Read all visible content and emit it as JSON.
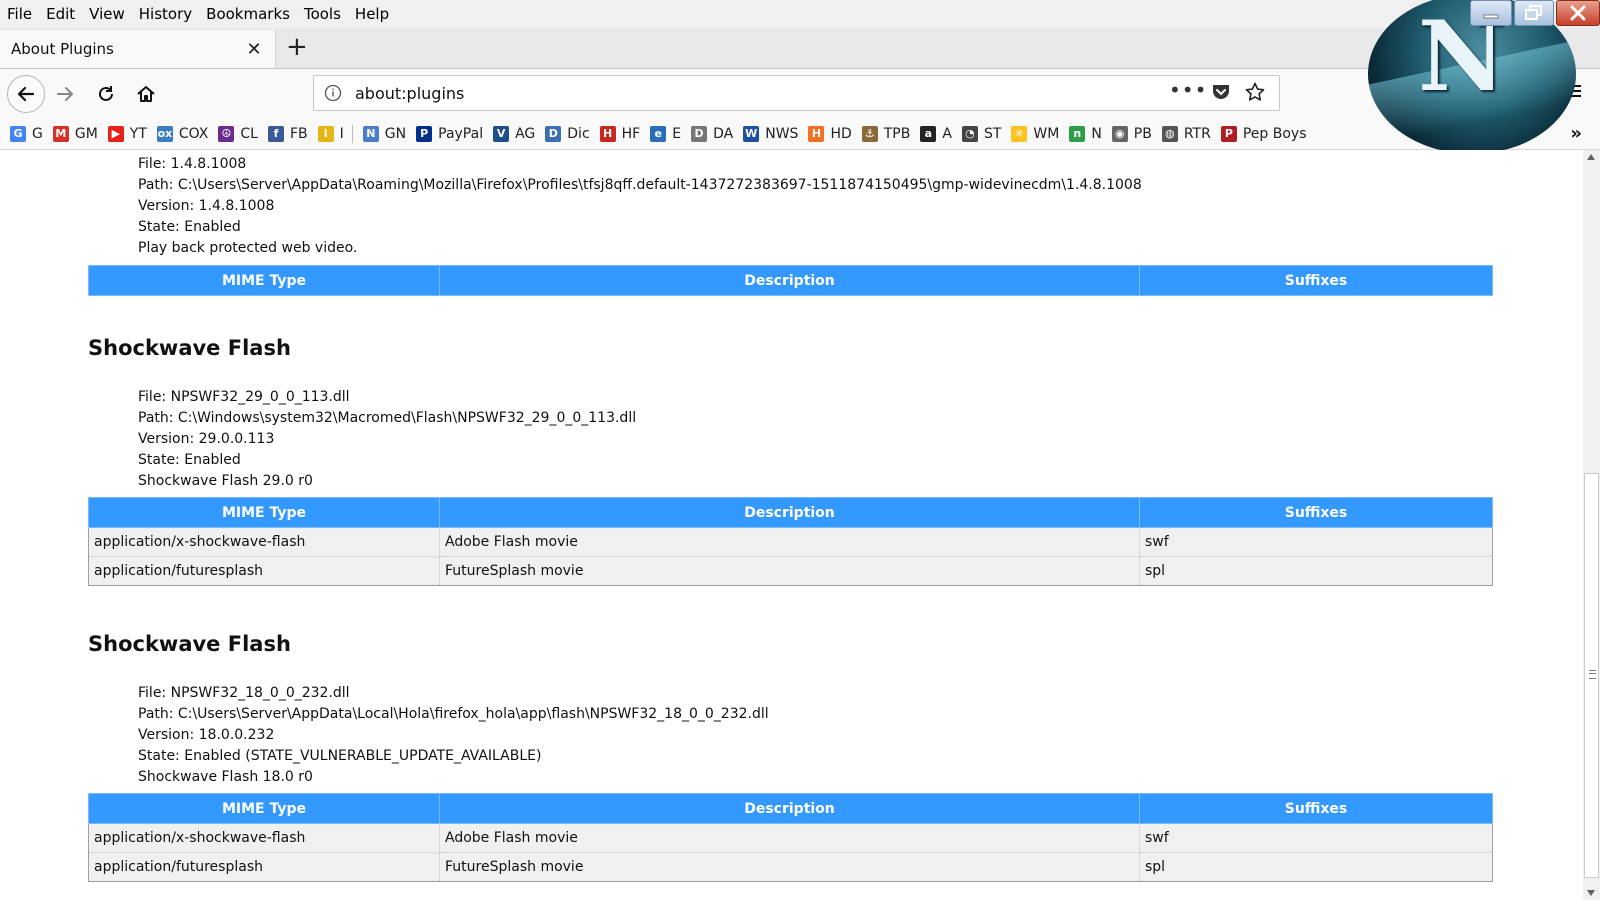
{
  "menu": [
    {
      "label": "File"
    },
    {
      "label": "Edit"
    },
    {
      "label": "View"
    },
    {
      "label": "History"
    },
    {
      "label": "Bookmarks"
    },
    {
      "label": "Tools"
    },
    {
      "label": "Help"
    }
  ],
  "tab": {
    "title": "About Plugins",
    "close": "✕",
    "new_tab": "+"
  },
  "urlbar": {
    "url": "about:plugins",
    "more": "•••"
  },
  "bookmarks": [
    {
      "label": "G",
      "icon": "google-icon",
      "color": "#4285f4",
      "glyph": "G"
    },
    {
      "label": "GM",
      "icon": "gmail-icon",
      "color": "#d93025",
      "glyph": "M"
    },
    {
      "label": "YT",
      "icon": "youtube-icon",
      "color": "#e62117",
      "glyph": "▶"
    },
    {
      "label": "COX",
      "icon": "cox-icon",
      "color": "#3a7fc1",
      "glyph": "ox"
    },
    {
      "label": "CL",
      "icon": "peace-icon",
      "color": "#6a2c91",
      "glyph": "☮"
    },
    {
      "label": "FB",
      "icon": "facebook-icon",
      "color": "#3b5998",
      "glyph": "f"
    },
    {
      "label": "I",
      "icon": "imdb-icon",
      "color": "#e2b616",
      "glyph": "i"
    },
    {
      "label": "GN",
      "icon": "google-news-icon",
      "color": "#4a7ec9",
      "glyph": "N"
    },
    {
      "label": "PayPal",
      "icon": "paypal-icon",
      "color": "#003087",
      "glyph": "P"
    },
    {
      "label": "AG",
      "icon": "ag-icon",
      "color": "#1e4f8a",
      "glyph": "V"
    },
    {
      "label": "Dic",
      "icon": "dictionary-icon",
      "color": "#3b6fb4",
      "glyph": "D"
    },
    {
      "label": "HF",
      "icon": "hf-icon",
      "color": "#c8281e",
      "glyph": "H"
    },
    {
      "label": "E",
      "icon": "ebay-icon",
      "color": "#2a6ebb",
      "glyph": "e"
    },
    {
      "label": "DA",
      "icon": "da-icon",
      "color": "#777777",
      "glyph": "D"
    },
    {
      "label": "NWS",
      "icon": "weather-channel-icon",
      "color": "#1f4fa0",
      "glyph": "W"
    },
    {
      "label": "HD",
      "icon": "home-depot-icon",
      "color": "#f36f21",
      "glyph": "H"
    },
    {
      "label": "TPB",
      "icon": "pirate-ship-icon",
      "color": "#8a6a3a",
      "glyph": "⚓"
    },
    {
      "label": "A",
      "icon": "amazon-icon",
      "color": "#222222",
      "glyph": "a"
    },
    {
      "label": "ST",
      "icon": "speedtest-icon",
      "color": "#444444",
      "glyph": "◔"
    },
    {
      "label": "WM",
      "icon": "walmart-icon",
      "color": "#ffc220",
      "glyph": "✳"
    },
    {
      "label": "N",
      "icon": "n-icon",
      "color": "#2e9d4a",
      "glyph": "n"
    },
    {
      "label": "PB",
      "icon": "camera-icon",
      "color": "#666666",
      "glyph": "◉"
    },
    {
      "label": "RTR",
      "icon": "globe-icon",
      "color": "#555555",
      "glyph": "◍"
    },
    {
      "label": "Pep Boys",
      "icon": "pep-boys-icon",
      "color": "#b01e23",
      "glyph": "P"
    }
  ],
  "bookmarks_overflow": "»",
  "plugins": [
    {
      "title": "",
      "file": "File: 1.4.8.1008",
      "path": "Path: C:\\Users\\Server\\AppData\\Roaming\\Mozilla\\Firefox\\Profiles\\tfsj8qff.default-1437272383697-1511874150495\\gmp-widevinecdm\\1.4.8.1008",
      "version": "Version: 1.4.8.1008",
      "state": "State: Enabled",
      "description": "Play back protected web video.",
      "headers": [
        "MIME Type",
        "Description",
        "Suffixes"
      ],
      "rows": []
    },
    {
      "title": "Shockwave Flash",
      "file": "File: NPSWF32_29_0_0_113.dll",
      "path": "Path: C:\\Windows\\system32\\Macromed\\Flash\\NPSWF32_29_0_0_113.dll",
      "version": "Version: 29.0.0.113",
      "state": "State: Enabled",
      "description": "Shockwave Flash 29.0 r0",
      "headers": [
        "MIME Type",
        "Description",
        "Suffixes"
      ],
      "rows": [
        [
          "application/x-shockwave-flash",
          "Adobe Flash movie",
          "swf"
        ],
        [
          "application/futuresplash",
          "FutureSplash movie",
          "spl"
        ]
      ]
    },
    {
      "title": "Shockwave Flash",
      "file": "File: NPSWF32_18_0_0_232.dll",
      "path": "Path: C:\\Users\\Server\\AppData\\Local\\Hola\\firefox_hola\\app\\flash\\NPSWF32_18_0_0_232.dll",
      "version": "Version: 18.0.0.232",
      "state": "State: Enabled (STATE_VULNERABLE_UPDATE_AVAILABLE)",
      "description": "Shockwave Flash 18.0 r0",
      "headers": [
        "MIME Type",
        "Description",
        "Suffixes"
      ],
      "rows": [
        [
          "application/x-shockwave-flash",
          "Adobe Flash movie",
          "swf"
        ],
        [
          "application/futuresplash",
          "FutureSplash movie",
          "spl"
        ]
      ]
    }
  ],
  "colors": {
    "table_header": "#3399ff",
    "row_bg": "#f0f0f0",
    "abp": "#d9242b"
  }
}
